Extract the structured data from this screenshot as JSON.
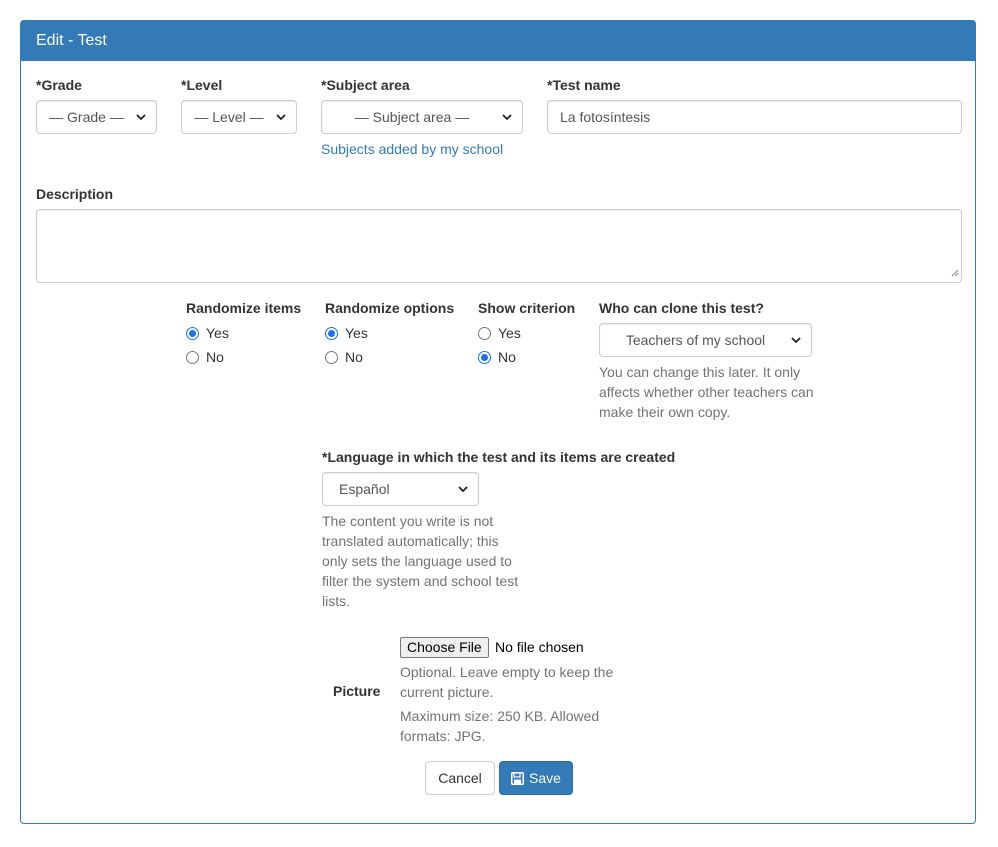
{
  "panel": {
    "title": "Edit - Test"
  },
  "fields": {
    "grade": {
      "label": "*Grade",
      "value": "— Grade —"
    },
    "level": {
      "label": "*Level",
      "value": "— Level —"
    },
    "subject": {
      "label": "*Subject area",
      "value": "— Subject area —",
      "link": "Subjects added by my school"
    },
    "test_name": {
      "label": "*Test name",
      "value": "La fotosíntesis"
    },
    "description": {
      "label": "Description",
      "value": ""
    }
  },
  "options": {
    "randomize_items": {
      "label": "Randomize items",
      "yes": "Yes",
      "no": "No",
      "selected": "Yes"
    },
    "randomize_options": {
      "label": "Randomize options",
      "yes": "Yes",
      "no": "No",
      "selected": "Yes"
    },
    "show_criterion": {
      "label": "Show criterion",
      "yes": "Yes",
      "no": "No",
      "selected": "No"
    },
    "clone": {
      "label": "Who can clone this test?",
      "value": "Teachers of my school",
      "help": "You can change this later. It only affects whether other teachers can make their own copy."
    }
  },
  "language": {
    "label": "*Language in which the test and its items are created",
    "value": "Español",
    "help": "The content you write is not translated automatically; this only sets the language used to filter the system and school test lists."
  },
  "picture": {
    "label": "Picture",
    "button": "Choose File",
    "status": "No file chosen",
    "help1": "Optional. Leave empty to keep the current picture.",
    "help2": "Maximum size: 250 KB. Allowed formats: JPG."
  },
  "actions": {
    "cancel": "Cancel",
    "save": "Save"
  },
  "colors": {
    "primary": "#337ab7",
    "radio_accent": "#1a73e8",
    "help_text": "#737373"
  },
  "icons": {
    "select": "chevron-down-icon",
    "save": "floppy-disk-icon"
  }
}
